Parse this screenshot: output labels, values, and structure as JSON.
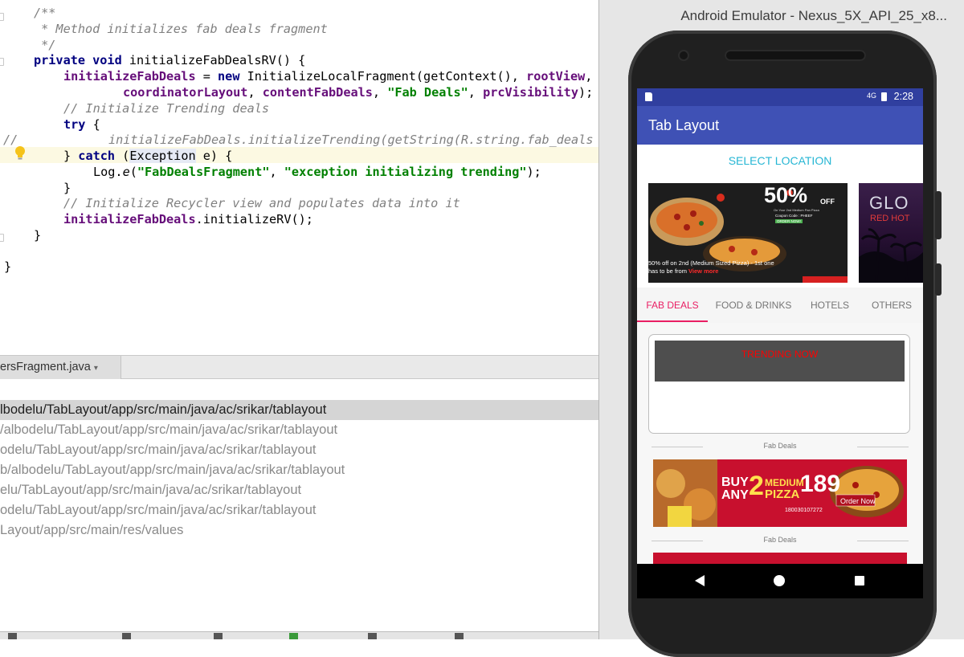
{
  "editor": {
    "lines": {
      "l1": "/**",
      "l2": " * Method initializes fab deals fragment",
      "l3": " */",
      "l4_kw": "private void",
      "l4_rest": " initializeFabDealsRV() {",
      "l5_field": "initializeFabDeals",
      "l5_eq": " = ",
      "l5_new": "new",
      "l5_rest": " InitializeLocalFragment(getContext(), ",
      "l5_field2": "rootView",
      "l5_tail": ",",
      "l6_f1": "coordinatorLayout",
      "l6_c1": ", ",
      "l6_f2": "contentFabDeals",
      "l6_c2": ", ",
      "l6_str": "\"Fab Deals\"",
      "l6_c3": ", ",
      "l6_f3": "prcVisibility",
      "l6_tail": ");",
      "l7": "// Initialize Trending deals",
      "l8_kw": "try",
      "l8_rest": " {",
      "l9_prefix": "//",
      "l9_code": "initializeFabDeals.initializeTrending(getString(R.string.fab_deals",
      "l10_a": "} ",
      "l10_kw": "catch",
      "l10_b": " (",
      "l10_sel": "Exception",
      "l10_c": " e) {",
      "l11_a": "Log.",
      "l11_m": "e",
      "l11_b": "(",
      "l11_s1": "\"FabDealsFragment\"",
      "l11_c": ", ",
      "l11_s2": "\"exception initializing trending\"",
      "l11_d": ");",
      "l12": "}",
      "l13": "// Initialize Recycler view and populates data into it",
      "l14_field": "initializeFabDeals",
      "l14_rest": ".initializeRV();",
      "l15": "}",
      "l16": "}"
    }
  },
  "panel": {
    "file_tab": "ersFragment.java",
    "file_tab_arrow": "▾",
    "paths": [
      "lbodelu/TabLayout/app/src/main/java/ac/srikar/tablayout",
      "/albodelu/TabLayout/app/src/main/java/ac/srikar/tablayout",
      "odelu/TabLayout/app/src/main/java/ac/srikar/tablayout",
      "b/albodelu/TabLayout/app/src/main/java/ac/srikar/tablayout",
      "elu/TabLayout/app/src/main/java/ac/srikar/tablayout",
      "odelu/TabLayout/app/src/main/java/ac/srikar/tablayout",
      "Layout/app/src/main/res/values"
    ]
  },
  "emulator": {
    "title": "Android Emulator - Nexus_5X_API_25_x8...",
    "status_time": "2:28",
    "status_network": "4G",
    "app_title": "Tab Layout",
    "select_location": "SELECT LOCATION",
    "tabs": [
      "FAB DEALS",
      "FOOD & DRINKS",
      "HOTELS",
      "OTHERS"
    ],
    "active_tab": "FAB DEALS",
    "trending": "TRENDING NOW",
    "section_labels": [
      "Fab Deals",
      "Fab Deals"
    ],
    "banner1": {
      "big": "50%",
      "off": "OFF",
      "sub": "On Your 2nd Medium Pan Pizza",
      "coupon": "Coupon Code : PHEEF",
      "cta": "ORDER NOW!",
      "caption1": "50% off on 2nd (Medium Sized Pizza) - 1st one",
      "caption2": "has to be from ",
      "view_more": "View more"
    },
    "banner2": {
      "word1": "GLO",
      "word2": "RED HOT"
    },
    "promo": {
      "buy": "BUY",
      "any": "ANY",
      "two": "2",
      "medium": "MEDIUM",
      "pizza": "PIZZA",
      "price": "189",
      "order": "Order Now",
      "phone": "180030107272"
    },
    "colors": {
      "status": "#303f9f",
      "appbar": "#3f51b5",
      "accent": "#e91e63",
      "location": "#26b6d4",
      "trending_text": "#ff0000"
    }
  }
}
